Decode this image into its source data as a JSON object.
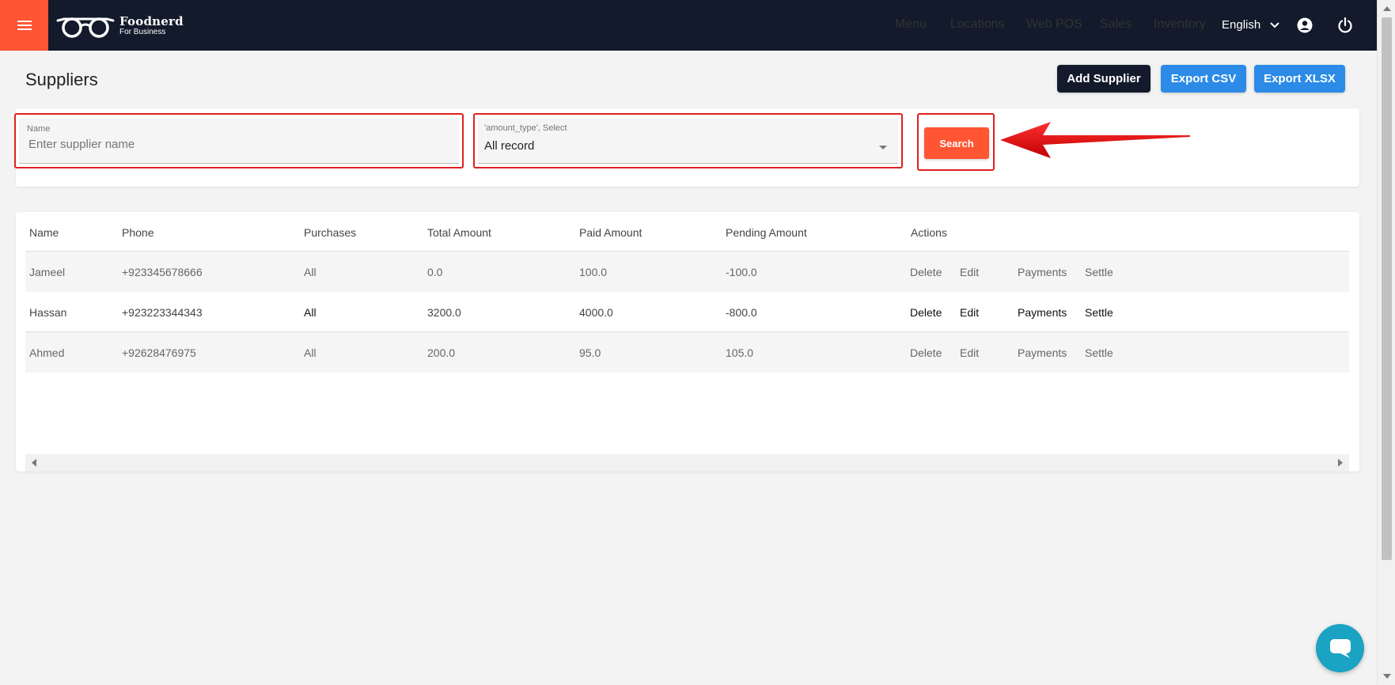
{
  "brand": {
    "name": "Foodnerd",
    "subtitle": "For Business"
  },
  "nav": {
    "items": [
      "Menu",
      "Locations",
      "Web POS",
      "Sales",
      "Inventory"
    ],
    "language": "English"
  },
  "page": {
    "title": "Suppliers"
  },
  "toolbar": {
    "add_supplier": "Add Supplier",
    "export_csv": "Export CSV",
    "export_xlsx": "Export XLSX"
  },
  "filters": {
    "name_label": "Name",
    "name_placeholder": "Enter supplier name",
    "select_label": "'amount_type', Select",
    "select_value": "All record",
    "search_label": "Search"
  },
  "table": {
    "columns": [
      "Name",
      "Phone",
      "Purchases",
      "Total Amount",
      "Paid Amount",
      "Pending Amount",
      "Actions"
    ],
    "actions": [
      "Delete",
      "Edit",
      "Payments",
      "Settle"
    ],
    "rows": [
      {
        "name": "Jameel",
        "phone": "+923345678666",
        "purchases": "All",
        "total": "0.0",
        "paid": "100.0",
        "pending": "-100.0"
      },
      {
        "name": "Hassan",
        "phone": "+923223344343",
        "purchases": "All",
        "total": "3200.0",
        "paid": "4000.0",
        "pending": "-800.0"
      },
      {
        "name": "Ahmed",
        "phone": "+92628476975",
        "purchases": "All",
        "total": "200.0",
        "paid": "95.0",
        "pending": "105.0"
      }
    ]
  },
  "colors": {
    "topbar": "#121a2b",
    "accent": "#ff5533",
    "blue": "#2b8be6",
    "highlight": "#e02020",
    "chat": "#1aa3c2"
  },
  "icons": [
    "menu-icon",
    "glasses-logo-icon",
    "chevron-down-icon",
    "account-icon",
    "power-icon",
    "chat-icon"
  ]
}
